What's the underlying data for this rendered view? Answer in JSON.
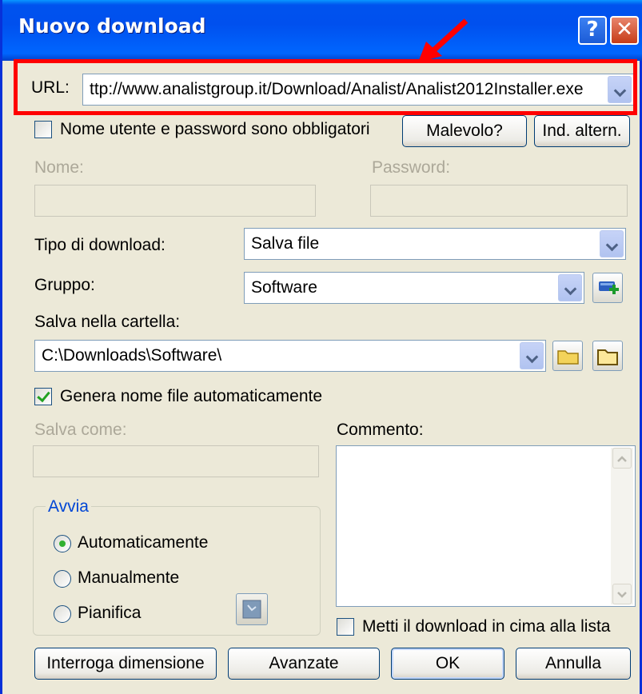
{
  "window": {
    "title": "Nuovo download"
  },
  "url": {
    "label": "URL:",
    "value": "ttp://www.analistgroup.it/Download/Analist/Analist2012Installer.exe"
  },
  "auth": {
    "checkbox_label": "Nome utente e password sono obbligatori",
    "checked": false,
    "name_label": "Nome:",
    "password_label": "Password:",
    "name_value": "",
    "password_value": ""
  },
  "buttons": {
    "malevolo": "Malevolo?",
    "ind_altern": "Ind. altern.",
    "interroga": "Interroga dimensione",
    "avanzate": "Avanzate",
    "ok": "OK",
    "annulla": "Annulla"
  },
  "download_type": {
    "label": "Tipo di download:",
    "value": "Salva file"
  },
  "group": {
    "label": "Gruppo:",
    "value": "Software"
  },
  "folder": {
    "label": "Salva nella cartella:",
    "value": "C:\\Downloads\\Software\\"
  },
  "auto_name": {
    "label": "Genera nome file automaticamente",
    "checked": true
  },
  "save_as": {
    "label": "Salva come:",
    "value": ""
  },
  "comment": {
    "label": "Commento:",
    "value": ""
  },
  "start": {
    "legend": "Avvia",
    "options": [
      "Automaticamente",
      "Manualmente",
      "Pianifica"
    ],
    "selected": "Automaticamente"
  },
  "top_of_list": {
    "label": "Metti il download in cima alla lista",
    "checked": false
  },
  "colors": {
    "titlebar": "#0054e3",
    "highlight": "#ff0000",
    "window_bg": "#ece9d8"
  }
}
